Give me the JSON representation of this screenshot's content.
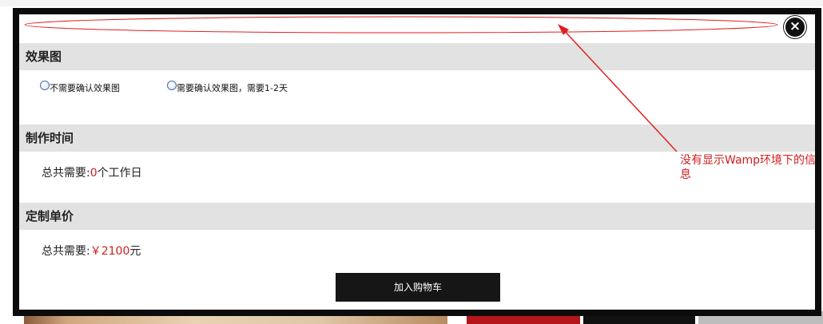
{
  "dialog": {
    "close_glyph": "×",
    "sections": {
      "effect": {
        "title": "效果图",
        "options": [
          {
            "label": "不需要确认效果图"
          },
          {
            "label": "需要确认效果图，需要1-2天"
          }
        ]
      },
      "production_time": {
        "title": "制作时间",
        "prefix": "总共需要:",
        "value": "0",
        "suffix": "个工作日"
      },
      "unit_price": {
        "title": "定制单价",
        "prefix": "总共需要:",
        "value": "￥2100",
        "suffix": "元"
      }
    },
    "add_to_cart_label": "加入购物车"
  },
  "annotation": {
    "text": "没有显示Wamp环境下的信息",
    "color": "#e02020"
  }
}
